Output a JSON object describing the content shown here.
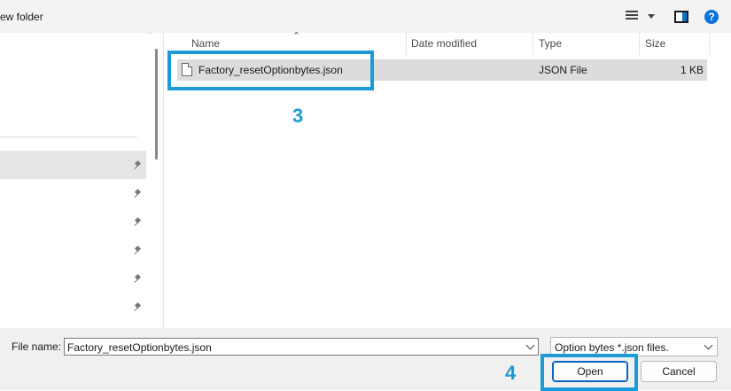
{
  "toolbar": {
    "new_folder_label": "ew folder",
    "help_symbol": "?",
    "icons": [
      "view-options-icon",
      "dropdown-caret-icon",
      "preview-pane-icon",
      "help-icon"
    ],
    "accent_color": "#0a74da"
  },
  "navigation": {
    "pinned_items": 6
  },
  "columns": [
    "Name",
    "Date modified",
    "Type",
    "Size"
  ],
  "files": [
    {
      "name": "Factory_resetOptionbytes.json",
      "date_modified": "",
      "type": "JSON File",
      "size": "1 KB",
      "selected": true
    }
  ],
  "callouts": [
    {
      "number": "3",
      "target": "file-row",
      "color": "#1c9bd8"
    },
    {
      "number": "4",
      "target": "open-button",
      "color": "#1c9bd8"
    }
  ],
  "bottom": {
    "file_name_label": "File name:",
    "file_name_value": "Factory_resetOptionbytes.json",
    "file_type_value": "Option bytes *.json files.",
    "open_label": "Open",
    "cancel_label": "Cancel"
  }
}
